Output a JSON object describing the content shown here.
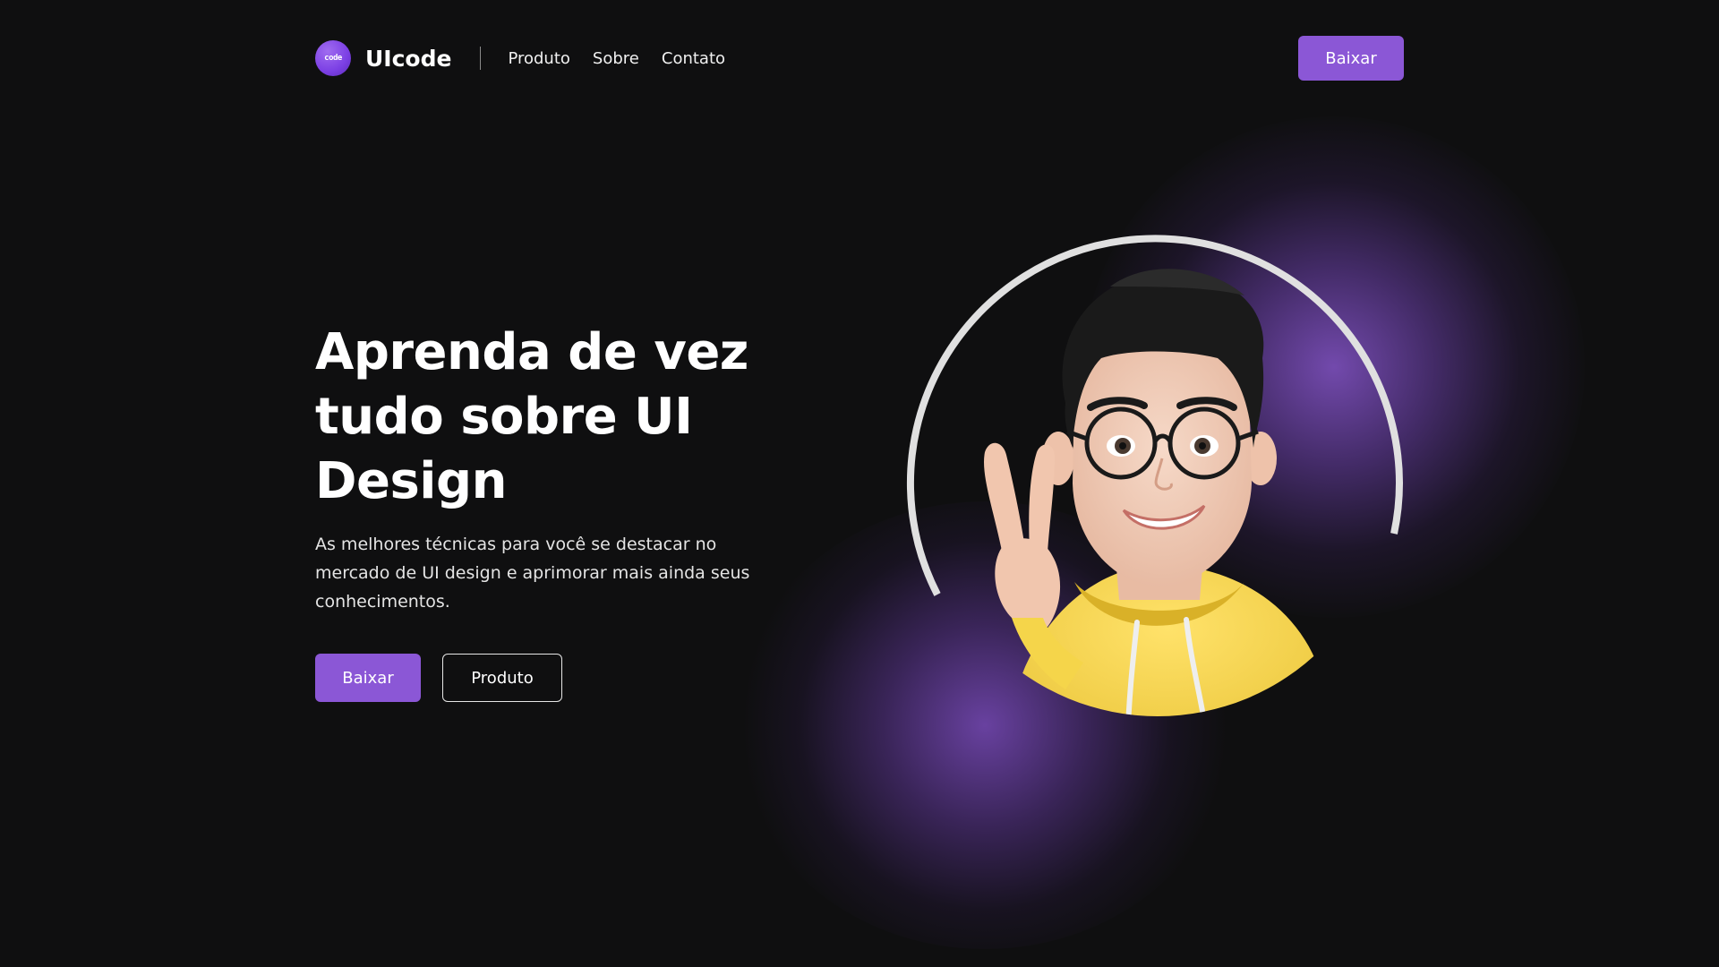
{
  "brand": {
    "logo_badge_text": "code",
    "name": "UIcode"
  },
  "nav": {
    "items": [
      {
        "label": "Produto"
      },
      {
        "label": "Sobre"
      },
      {
        "label": "Contato"
      }
    ],
    "cta_label": "Baixar"
  },
  "hero": {
    "title": "Aprenda de vez tudo sobre UI Design",
    "subtitle": "As melhores técnicas para você se destacar no mercado de UI design e aprimorar mais ainda seus conhecimentos.",
    "primary_button": "Baixar",
    "secondary_button": "Produto"
  },
  "illustration": {
    "subject": "avatar-peace-sign",
    "ring_color": "#e0e0e0",
    "hoodie_color": "#f5d54a"
  },
  "colors": {
    "background": "#0f0f10",
    "accent": "#8b57d6",
    "glow": "#7a4bc0",
    "text": "#ffffff"
  }
}
